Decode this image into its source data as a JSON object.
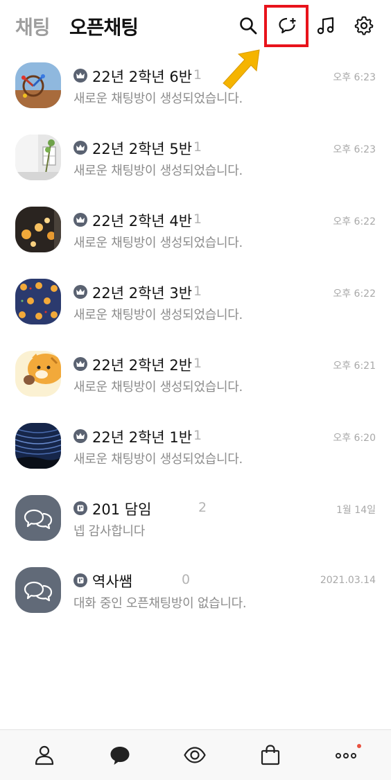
{
  "header": {
    "tab_chat": "채팅",
    "tab_openchat": "오픈채팅",
    "icons": [
      "search-icon",
      "new-openchat-icon",
      "music-icon",
      "settings-icon"
    ]
  },
  "rooms": [
    {
      "title": "22년 2학년 6반",
      "count": "1",
      "preview": "새로운 채팅방이 생성되었습니다.",
      "time": "오후 6:23",
      "badge": "crown-icon"
    },
    {
      "title": "22년 2학년 5반",
      "count": "1",
      "preview": "새로운 채팅방이 생성되었습니다.",
      "time": "오후 6:23",
      "badge": "crown-icon"
    },
    {
      "title": "22년 2학년 4반",
      "count": "1",
      "preview": "새로운 채팅방이 생성되었습니다.",
      "time": "오후 6:22",
      "badge": "crown-icon"
    },
    {
      "title": "22년 2학년 3반",
      "count": "1",
      "preview": "새로운 채팅방이 생성되었습니다.",
      "time": "오후 6:22",
      "badge": "crown-icon"
    },
    {
      "title": "22년 2학년 2반",
      "count": "1",
      "preview": "새로운 채팅방이 생성되었습니다.",
      "time": "오후 6:21",
      "badge": "crown-icon"
    },
    {
      "title": "22년 2학년 1반",
      "count": "1",
      "preview": "새로운 채팅방이 생성되었습니다.",
      "time": "오후 6:20",
      "badge": "crown-icon"
    },
    {
      "title": "201 담임",
      "count": "2",
      "preview": "넵 감사합니다",
      "time": "1월 14일",
      "badge": "profile-card-icon"
    },
    {
      "title": "역사쌤",
      "count": "0",
      "preview": "대화 중인 오픈채팅방이 없습니다.",
      "time": "2021.03.14",
      "badge": "profile-card-icon"
    }
  ],
  "bottom_nav": {
    "items": [
      "friends-icon",
      "chats-icon",
      "view-icon",
      "shopping-icon",
      "more-icon"
    ],
    "notification_color": "#e8513f"
  },
  "colors": {
    "highlight": "#e8131b",
    "arrow": "#f5b400",
    "badge": "#5a6271"
  }
}
